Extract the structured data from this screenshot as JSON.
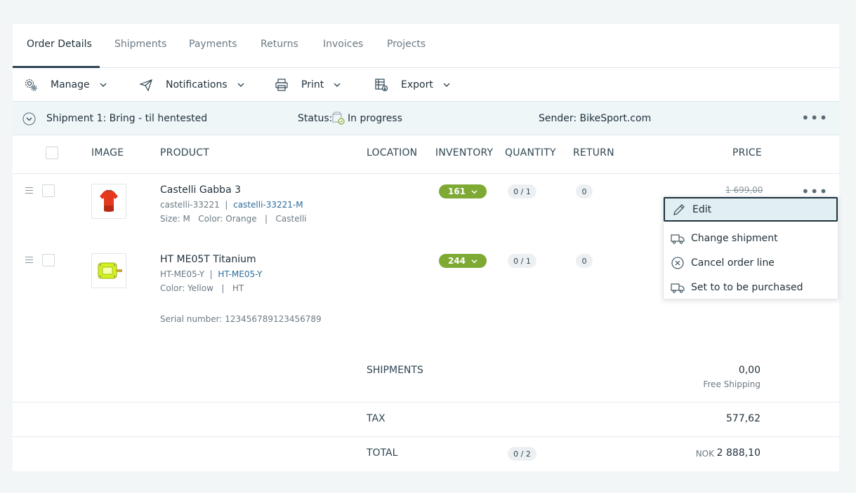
{
  "tabs": [
    "Order Details",
    "Shipments",
    "Payments",
    "Returns",
    "Invoices",
    "Projects"
  ],
  "toolbar": {
    "manage": "Manage",
    "notifications": "Notifications",
    "print": "Print",
    "export": "Export"
  },
  "shipment": {
    "title": "Shipment 1: Bring - til hentested",
    "status_label": "Status:",
    "status_value": "In progress",
    "sender": "Sender: BikeSport.com"
  },
  "columns": {
    "image": "IMAGE",
    "product": "PRODUCT",
    "location": "LOCATION",
    "inventory": "INVENTORY",
    "quantity": "QUANTITY",
    "return": "RETURN",
    "price": "PRICE"
  },
  "items": [
    {
      "name": "Castelli Gabba 3",
      "sku": "castelli-33221",
      "sku_link": "castelli-33221-M",
      "attributes": "Size: M   Color: Orange   |   Castelli",
      "inventory": "161",
      "quantity": "0 / 1",
      "return": "0",
      "price_strike": "1 699,00"
    },
    {
      "name": "HT ME05T Titanium",
      "sku": "HT-ME05-Y",
      "sku_link": "HT-ME05-Y",
      "attributes": "Color: Yellow   |   HT",
      "serial": "Serial number: 123456789123456789",
      "inventory": "244",
      "quantity": "0 / 1",
      "return": "0"
    }
  ],
  "summary": {
    "shipments_label": "SHIPMENTS",
    "shipments_value": "0,00",
    "shipments_note": "Free Shipping",
    "tax_label": "TAX",
    "tax_value": "577,62",
    "total_label": "TOTAL",
    "total_qty": "0 / 2",
    "total_currency": "NOK",
    "total_value": "2 888,10"
  },
  "menu": {
    "edit": "Edit",
    "change_shipment": "Change shipment",
    "cancel_order_line": "Cancel order line",
    "set_to_be_purchased": "Set to to be purchased"
  },
  "colors": {
    "inventory_pill": "#7ea933",
    "link": "#2c6c9c",
    "tab_underline": "#2f4654",
    "shipment_bar": "#eef6f8"
  }
}
